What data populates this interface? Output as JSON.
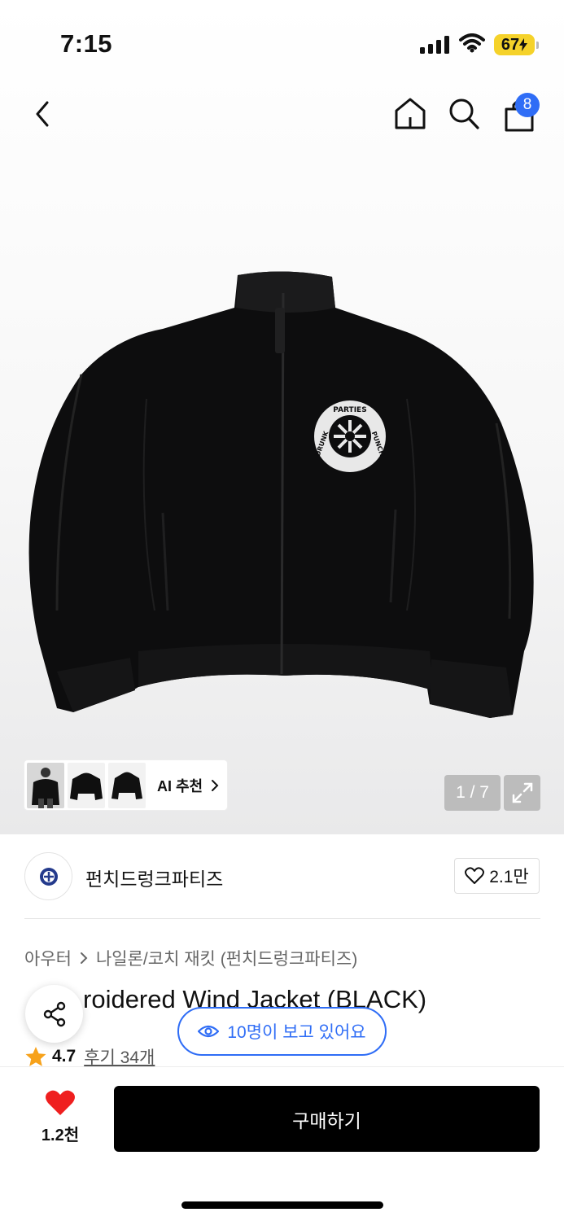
{
  "status_bar": {
    "time": "7:15",
    "battery": "67"
  },
  "header": {
    "icons": {
      "back": "chevron-left-icon",
      "home": "home-icon",
      "search": "search-icon",
      "cart": "shopping-bag-icon"
    },
    "cart_badge": "8"
  },
  "gallery": {
    "thumbnails": [
      "thumbnail-1",
      "thumbnail-2",
      "thumbnail-3"
    ],
    "ai_label": "AI 추천",
    "counter": "1 / 7",
    "logo_text": [
      "PARTIES",
      "PUNCH",
      "DRUNK"
    ]
  },
  "brand": {
    "name": "펀치드렁크파티즈",
    "likes": "2.1만"
  },
  "breadcrumb": {
    "level1": "아우터",
    "level2": "나일론/코치 재킷 (펀치드렁크파티즈)"
  },
  "product": {
    "title_visible": "roidered Wind Jacket (BLACK)",
    "rating": "4.7",
    "reviews": "후기 34개"
  },
  "viewers_pill": "10명이 보고 있어요",
  "bottom_bar": {
    "wish_count": "1.2천",
    "buy_label": "구매하기"
  },
  "colors": {
    "accent": "#2f6df6",
    "heart": "#ef1f1f",
    "star": "#f7a21b",
    "battery": "#f5d22a"
  }
}
